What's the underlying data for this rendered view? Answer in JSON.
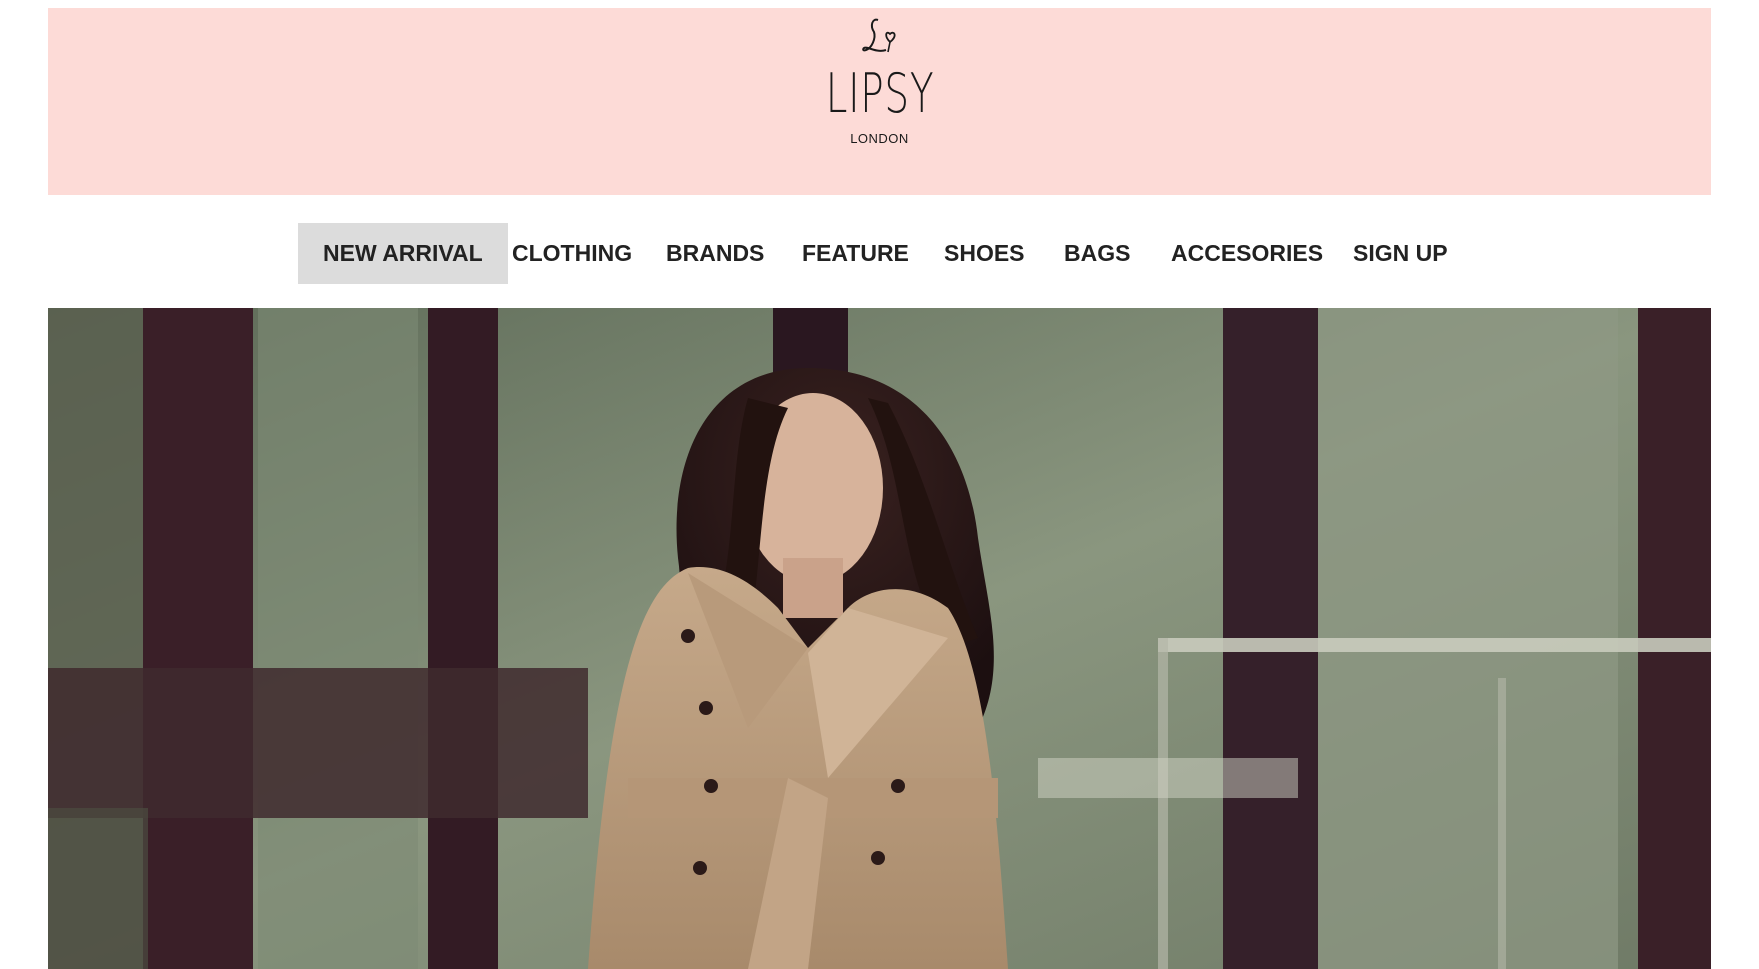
{
  "brand": {
    "logo_monogram": "L♡",
    "logo_wordmark": "LIPSY",
    "logo_subtext": "LONDON",
    "banner_color": "#fddbd7"
  },
  "nav": {
    "items": [
      {
        "label": "NEW ARRIVAL",
        "active": true
      },
      {
        "label": "CLOTHING",
        "active": false
      },
      {
        "label": "BRANDS",
        "active": false
      },
      {
        "label": "FEATURE",
        "active": false
      },
      {
        "label": "SHOES",
        "active": false
      },
      {
        "label": "BAGS",
        "active": false
      },
      {
        "label": "ACCESORIES",
        "active": false
      },
      {
        "label": "SIGN UP",
        "active": false
      }
    ],
    "active_bg": "#dcdcdc",
    "text_color": "#222222"
  },
  "hero": {
    "image_subject": "model-in-beige-trench-coat-photo",
    "tone": "#6e7a66"
  }
}
